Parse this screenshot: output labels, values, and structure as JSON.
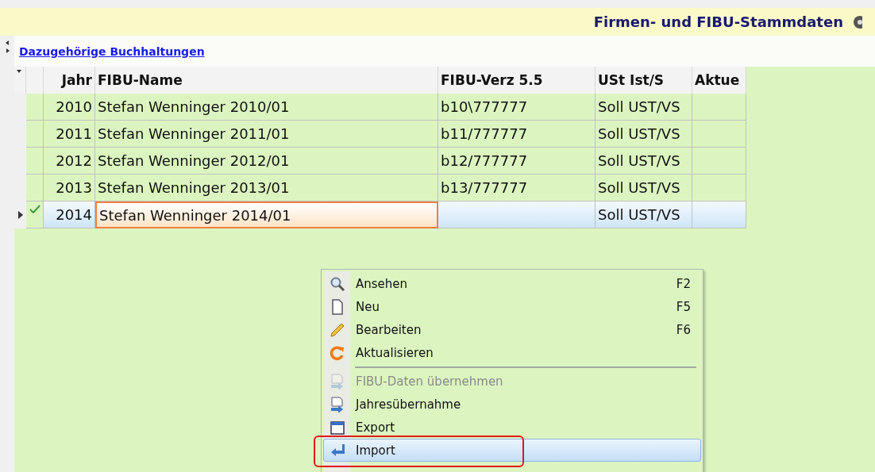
{
  "header": {
    "title": "Firmen- und FIBU-Stammdaten"
  },
  "section": {
    "link": "Dazugehörige Buchhaltungen"
  },
  "table": {
    "columns": [
      "Jahr",
      "FIBU-Name",
      "FIBU-Verz 5.5",
      "USt Ist/S",
      "Aktue"
    ],
    "rows": [
      {
        "cells": [
          "2010",
          "Stefan Wenninger 2010/01",
          "b10\\777777",
          "Soll UST/VS",
          ""
        ],
        "selected": false,
        "checked": false
      },
      {
        "cells": [
          "2011",
          "Stefan Wenninger 2011/01",
          "b11/777777",
          "Soll UST/VS",
          ""
        ],
        "selected": false,
        "checked": false
      },
      {
        "cells": [
          "2012",
          "Stefan Wenninger 2012/01",
          "b12/777777",
          "Soll UST/VS",
          ""
        ],
        "selected": false,
        "checked": false
      },
      {
        "cells": [
          "2013",
          "Stefan Wenninger 2013/01",
          "b13/777777",
          "Soll UST/VS",
          ""
        ],
        "selected": false,
        "checked": false
      },
      {
        "cells": [
          "2014",
          "Stefan Wenninger 2014/01",
          "",
          "Soll UST/VS",
          ""
        ],
        "selected": true,
        "checked": true
      }
    ]
  },
  "context_menu": {
    "items": [
      {
        "kind": "item",
        "label": "Ansehen",
        "shortcut": "F2",
        "disabled": false,
        "selected": false,
        "marked": false
      },
      {
        "kind": "item",
        "label": "Neu",
        "shortcut": "F5",
        "disabled": false,
        "selected": false,
        "marked": false
      },
      {
        "kind": "item",
        "label": "Bearbeiten",
        "shortcut": "F6",
        "disabled": false,
        "selected": false,
        "marked": false
      },
      {
        "kind": "item",
        "label": "Aktualisieren",
        "disabled": false,
        "selected": false,
        "marked": false
      },
      {
        "kind": "separator"
      },
      {
        "kind": "item",
        "label": "FIBU-Daten übernehmen",
        "disabled": true,
        "selected": false,
        "marked": false
      },
      {
        "kind": "item",
        "label": "Jahresübernahme",
        "disabled": false,
        "selected": false,
        "marked": false
      },
      {
        "kind": "item",
        "label": "Export",
        "disabled": false,
        "selected": false,
        "marked": false
      },
      {
        "kind": "item",
        "label": "Import",
        "disabled": false,
        "selected": true,
        "marked": true
      }
    ]
  }
}
